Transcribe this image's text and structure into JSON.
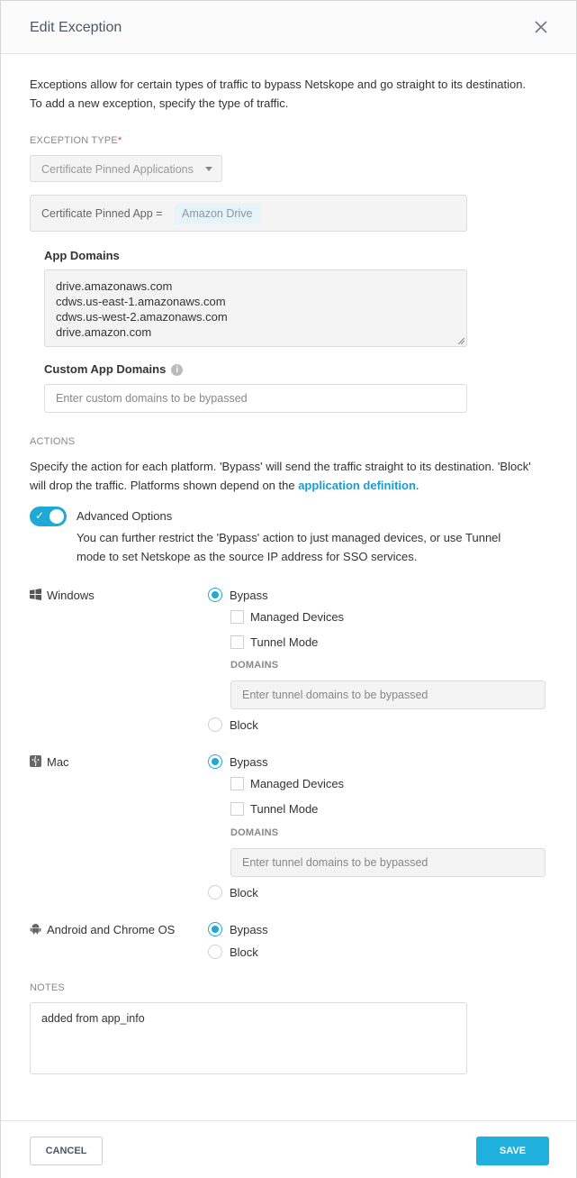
{
  "header": {
    "title": "Edit Exception"
  },
  "intro": "Exceptions allow for certain types of traffic to bypass Netskope and go straight to its destination. To add a new exception, specify the type of traffic.",
  "exception_type": {
    "label": "EXCEPTION TYPE",
    "required_mark": "*",
    "selected": "Certificate Pinned Applications",
    "pinned_label": "Certificate Pinned App =",
    "pinned_value": "Amazon Drive"
  },
  "app_domains": {
    "label": "App Domains",
    "lines": [
      "drive.amazonaws.com",
      "cdws.us-east-1.amazonaws.com",
      "cdws.us-west-2.amazonaws.com",
      "drive.amazon.com"
    ]
  },
  "custom_domains": {
    "label": "Custom App Domains",
    "placeholder": "Enter custom domains to be bypassed"
  },
  "actions": {
    "label": "ACTIONS",
    "desc_part1": "Specify the action for each platform. 'Bypass' will send the traffic straight to its destination. 'Block' will drop the traffic. Platforms shown depend on the ",
    "link": "application definition",
    "desc_part2": ".",
    "advanced_label": "Advanced Options",
    "advanced_desc": "You can further restrict the 'Bypass' action to just managed devices, or use Tunnel mode to set Netskope as the source IP address for SSO services.",
    "advanced_enabled": true
  },
  "platforms": {
    "windows": {
      "name": "Windows",
      "bypass": "Bypass",
      "managed": "Managed Devices",
      "tunnel": "Tunnel Mode",
      "domains_label": "DOMAINS",
      "domains_placeholder": "Enter tunnel domains to be bypassed",
      "block": "Block"
    },
    "mac": {
      "name": "Mac",
      "bypass": "Bypass",
      "managed": "Managed Devices",
      "tunnel": "Tunnel Mode",
      "domains_label": "DOMAINS",
      "domains_placeholder": "Enter tunnel domains to be bypassed",
      "block": "Block"
    },
    "android": {
      "name": "Android and Chrome OS",
      "bypass": "Bypass",
      "block": "Block"
    }
  },
  "notes": {
    "label": "NOTES",
    "value": "added from app_info"
  },
  "footer": {
    "cancel": "CANCEL",
    "save": "SAVE"
  },
  "colors": {
    "accent": "#1fb0dd",
    "link": "#1f9bd1",
    "required": "#e0413b"
  }
}
